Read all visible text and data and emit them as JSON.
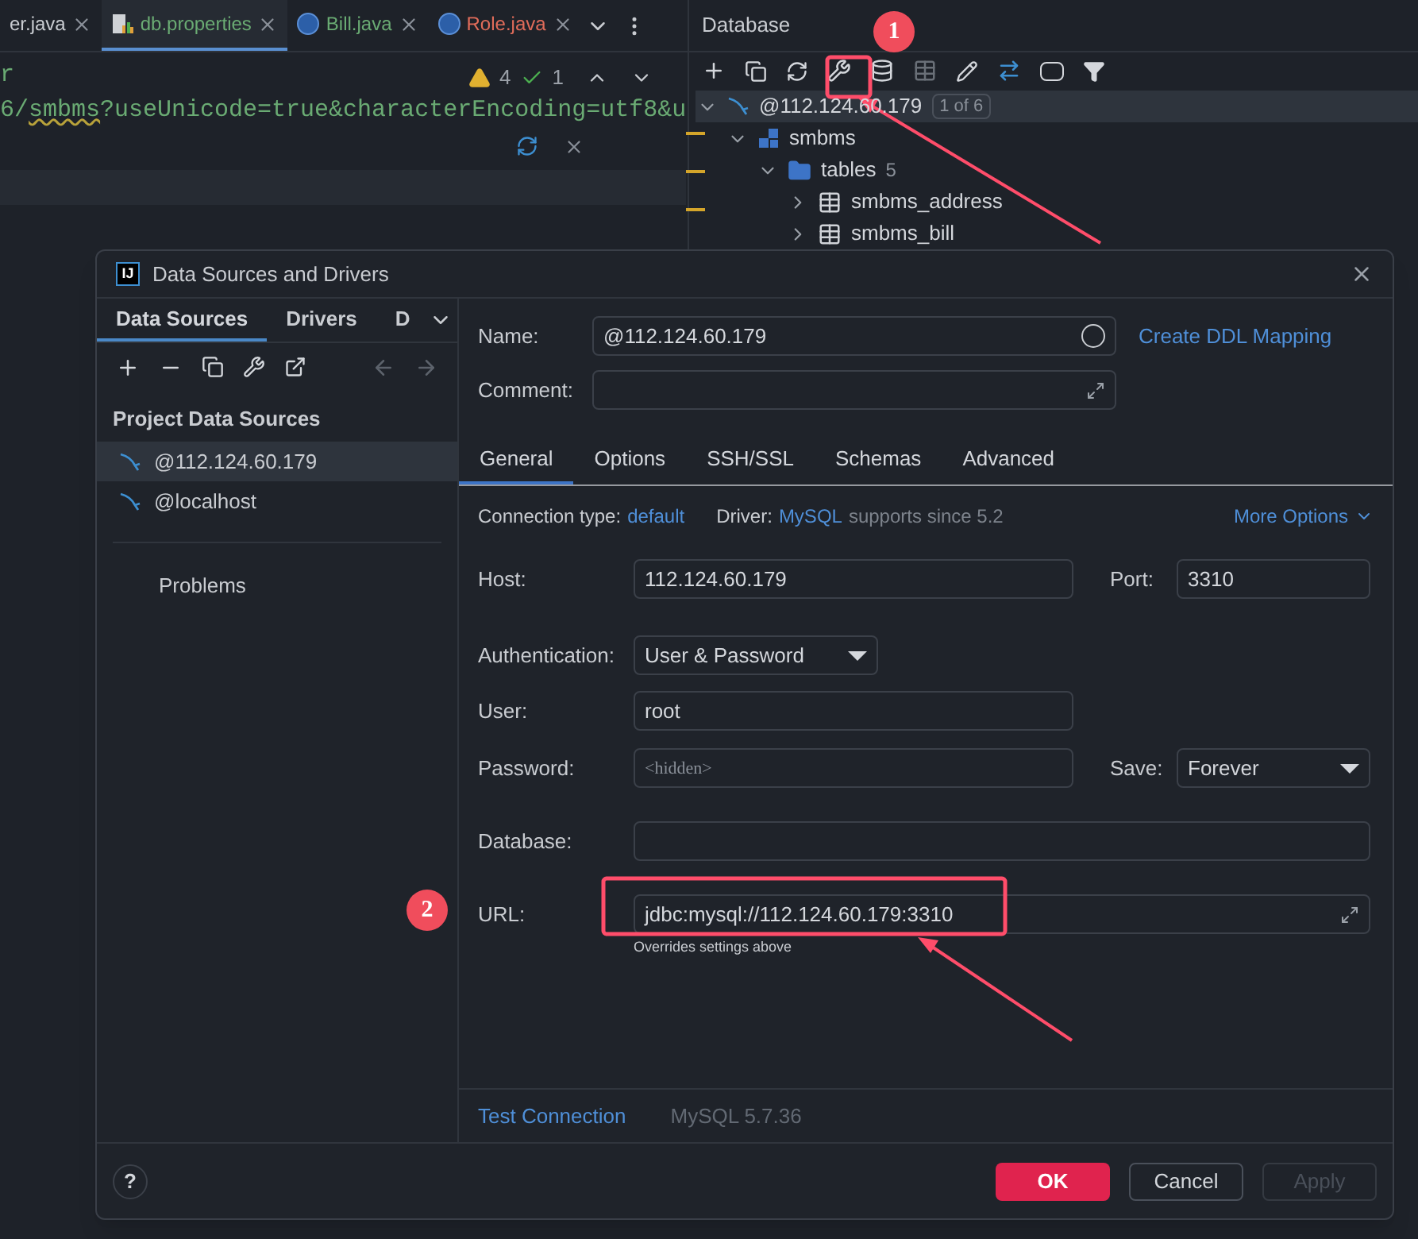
{
  "editor": {
    "tabs": [
      {
        "label": "er.java",
        "kind": "plain",
        "color": "#c9ccd1",
        "selected": false
      },
      {
        "label": "db.properties",
        "kind": "properties",
        "color": "#6aab73",
        "selected": true
      },
      {
        "label": "Bill.java",
        "kind": "class",
        "color": "#6aab73",
        "selected": false
      },
      {
        "label": "Role.java",
        "kind": "class",
        "color": "#e06c5a",
        "selected": false
      }
    ],
    "code_lines": [
      [
        {
          "text": "r",
          "warning": false
        }
      ],
      [
        {
          "text": "6/",
          "warning": false
        },
        {
          "text": "smbms",
          "warning": true
        },
        {
          "text": "?useUnicode=true&characterEncoding=utf8&u",
          "warning": false
        }
      ]
    ],
    "warnings": "4",
    "passed": "1"
  },
  "database_panel": {
    "title": "Database",
    "tree": [
      {
        "label": "@112.124.60.179",
        "badge": "1 of 6",
        "kind": "connection",
        "expanded": true,
        "selected": true,
        "children": [
          {
            "label": "smbms",
            "kind": "schema",
            "expanded": true,
            "selected": false,
            "children": [
              {
                "label": "tables",
                "count": "5",
                "kind": "folder",
                "expanded": true,
                "selected": false,
                "children": [
                  {
                    "label": "smbms_address",
                    "kind": "table",
                    "expanded": false,
                    "selected": false
                  },
                  {
                    "label": "smbms_bill",
                    "kind": "table",
                    "expanded": false,
                    "selected": false
                  }
                ]
              }
            ]
          }
        ]
      }
    ]
  },
  "dialog": {
    "logo": "IJ",
    "title": "Data Sources and Drivers",
    "left_tabs": [
      {
        "label": "Data Sources",
        "selected": true
      },
      {
        "label": "Drivers",
        "selected": false
      },
      {
        "label": "D",
        "selected": false
      }
    ],
    "section": "Project Data Sources",
    "sources": [
      {
        "label": "@112.124.60.179",
        "selected": true
      },
      {
        "label": "@localhost",
        "selected": false
      }
    ],
    "problems": "Problems",
    "name": {
      "label": "Name:",
      "value": "@112.124.60.179"
    },
    "comment": {
      "label": "Comment:"
    },
    "ddl_link": "Create DDL Mapping",
    "tabs": [
      {
        "label": "General",
        "selected": true
      },
      {
        "label": "Options",
        "selected": false
      },
      {
        "label": "SSH/SSL",
        "selected": false
      },
      {
        "label": "Schemas",
        "selected": false
      },
      {
        "label": "Advanced",
        "selected": false
      }
    ],
    "connection_type": {
      "label": "Connection type:",
      "value": "default"
    },
    "driver": {
      "label": "Driver:",
      "value": "MySQL",
      "note": "supports since 5.2"
    },
    "more_options": "More Options",
    "host": {
      "label": "Host:",
      "value": "112.124.60.179"
    },
    "port": {
      "label": "Port:",
      "value": "3310"
    },
    "authentication": {
      "label": "Authentication:",
      "value": "User & Password"
    },
    "user": {
      "label": "User:",
      "value": "root"
    },
    "password": {
      "label": "Password:",
      "placeholder": "<hidden>"
    },
    "save": {
      "label": "Save:",
      "value": "Forever"
    },
    "database": {
      "label": "Database:"
    },
    "url": {
      "label": "URL:",
      "value": "jdbc:mysql://112.124.60.179:3310",
      "hint": "Overrides settings above"
    },
    "test_connection": "Test Connection",
    "server_version": "MySQL 5.7.36",
    "help": "?",
    "buttons": [
      {
        "label": "OK",
        "kind": "primary",
        "disabled": false
      },
      {
        "label": "Cancel",
        "kind": "normal",
        "disabled": false
      },
      {
        "label": "Apply",
        "kind": "normal",
        "disabled": true
      }
    ]
  },
  "annotations": [
    {
      "label": "1"
    },
    {
      "label": "2"
    }
  ]
}
